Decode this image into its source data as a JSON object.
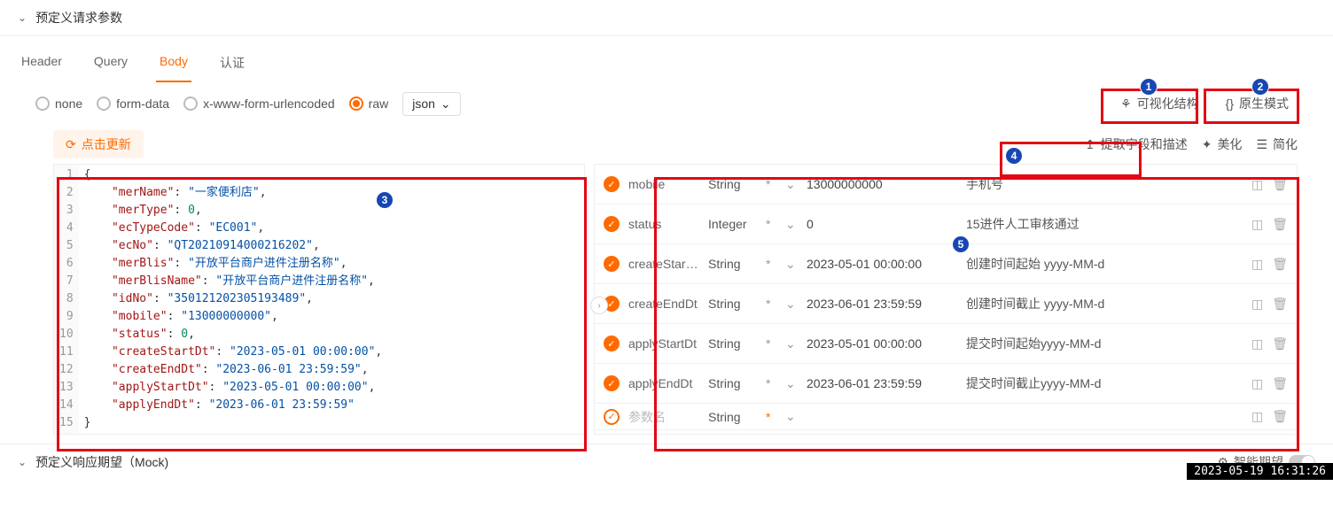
{
  "section1": {
    "title": "预定义请求参数"
  },
  "tabs": {
    "header": "Header",
    "query": "Query",
    "body": "Body",
    "auth": "认证",
    "active": "Body"
  },
  "bodyTypes": {
    "none": "none",
    "formData": "form-data",
    "xwww": "x-www-form-urlencoded",
    "raw": "raw",
    "selected": "raw"
  },
  "format": "json",
  "viewModes": {
    "visual": "可视化结构",
    "native": "原生模式"
  },
  "updateBtn": "点击更新",
  "actions": {
    "extract": "提取字段和描述",
    "beautify": "美化",
    "simplify": "简化"
  },
  "code": {
    "line1": "{",
    "line2": {
      "k": "merName",
      "v": "一家便利店",
      "comma": ","
    },
    "line3": {
      "k": "merType",
      "v": 0,
      "comma": ","
    },
    "line4": {
      "k": "ecTypeCode",
      "v": "EC001",
      "comma": ","
    },
    "line5": {
      "k": "ecNo",
      "v": "QT20210914000216202",
      "comma": ","
    },
    "line6": {
      "k": "merBlis",
      "v": "开放平台商户进件注册名称",
      "comma": ","
    },
    "line7": {
      "k": "merBlisName",
      "v": "开放平台商户进件注册名称",
      "comma": ","
    },
    "line8": {
      "k": "idNo",
      "v": "350121202305193489",
      "comma": ","
    },
    "line9": {
      "k": "mobile",
      "v": "13000000000",
      "comma": ","
    },
    "line10": {
      "k": "status",
      "v": 0,
      "comma": ","
    },
    "line11": {
      "k": "createStartDt",
      "v": "2023-05-01 00:00:00",
      "comma": ","
    },
    "line12": {
      "k": "createEndDt",
      "v": "2023-06-01 23:59:59",
      "comma": ","
    },
    "line13": {
      "k": "applyStartDt",
      "v": "2023-05-01 00:00:00",
      "comma": ","
    },
    "line14": {
      "k": "applyEndDt",
      "v": "2023-06-01 23:59:59",
      "comma": ""
    },
    "line15": "}"
  },
  "params": [
    {
      "name": "mobile",
      "type": "String",
      "req": "*",
      "value": "13000000000",
      "desc": "手机号"
    },
    {
      "name": "status",
      "type": "Integer",
      "req": "*",
      "value": "0",
      "desc": "15进件人工审核通过"
    },
    {
      "name": "createStartDt",
      "type": "String",
      "req": "*",
      "value": "2023-05-01 00:00:00",
      "desc": "创建时间起始 yyyy-MM-d"
    },
    {
      "name": "createEndDt",
      "type": "String",
      "req": "*",
      "value": "2023-06-01 23:59:59",
      "desc": "创建时间截止 yyyy-MM-d"
    },
    {
      "name": "applyStartDt",
      "type": "String",
      "req": "*",
      "value": "2023-05-01 00:00:00",
      "desc": "提交时间起始yyyy-MM-d"
    },
    {
      "name": "applyEndDt",
      "type": "String",
      "req": "*",
      "value": "2023-06-01 23:59:59",
      "desc": "提交时间截止yyyy-MM-d"
    },
    {
      "name": "参数名",
      "type": "String",
      "req": "*",
      "value": "",
      "desc": ""
    }
  ],
  "section2": {
    "title": "预定义响应期望（Mock)",
    "smart": "智能期望"
  },
  "timestamp": "2023-05-19 16:31:26",
  "annotations": {
    "b1": "1",
    "b2": "2",
    "b3": "3",
    "b4": "4",
    "b5": "5"
  }
}
